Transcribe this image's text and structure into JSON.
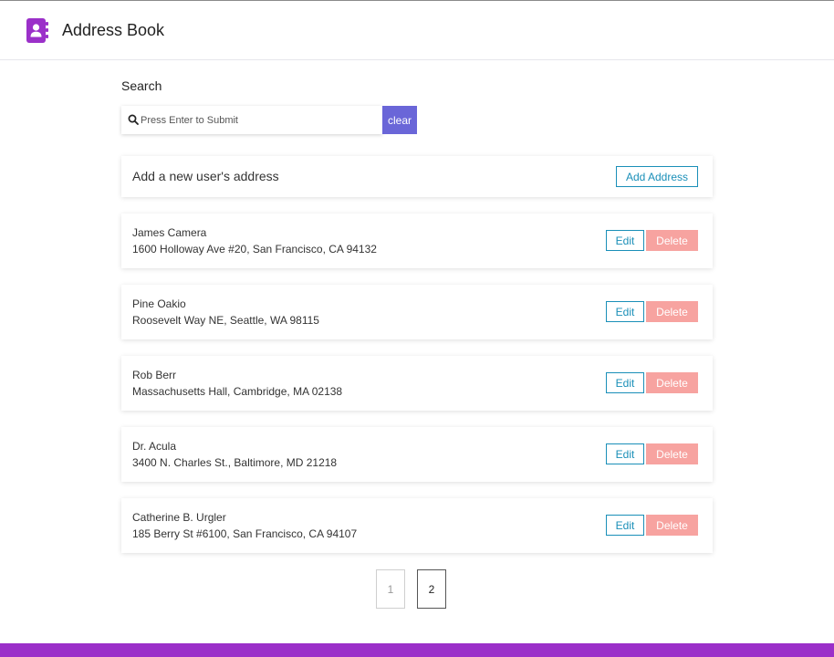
{
  "header": {
    "title": "Address Book"
  },
  "search": {
    "label": "Search",
    "placeholder": "Press Enter to Submit",
    "clear_label": "clear"
  },
  "add_card": {
    "text": "Add a new user's address",
    "button_label": "Add Address"
  },
  "contacts": [
    {
      "name": "James Camera",
      "address": "1600 Holloway Ave #20, San Francisco, CA 94132",
      "edit_label": "Edit",
      "delete_label": "Delete"
    },
    {
      "name": "Pine Oakio",
      "address": "Roosevelt Way NE, Seattle, WA 98115",
      "edit_label": "Edit",
      "delete_label": "Delete"
    },
    {
      "name": "Rob Berr",
      "address": "Massachusetts Hall, Cambridge, MA 02138",
      "edit_label": "Edit",
      "delete_label": "Delete"
    },
    {
      "name": "Dr. Acula",
      "address": "3400 N. Charles St., Baltimore, MD 21218",
      "edit_label": "Edit",
      "delete_label": "Delete"
    },
    {
      "name": "Catherine B. Urgler",
      "address": "185 Berry St #6100, San Francisco, CA 94107",
      "edit_label": "Edit",
      "delete_label": "Delete"
    }
  ],
  "pagination": {
    "pages": [
      "1",
      "2"
    ],
    "current": "2"
  },
  "colors": {
    "brand": "#9b30c9",
    "accent": "#1a8fb8",
    "clear_button": "#6a66d8",
    "delete_button": "#f7a3a0"
  },
  "icons": {
    "logo": "address-book-icon",
    "search": "search-icon"
  }
}
